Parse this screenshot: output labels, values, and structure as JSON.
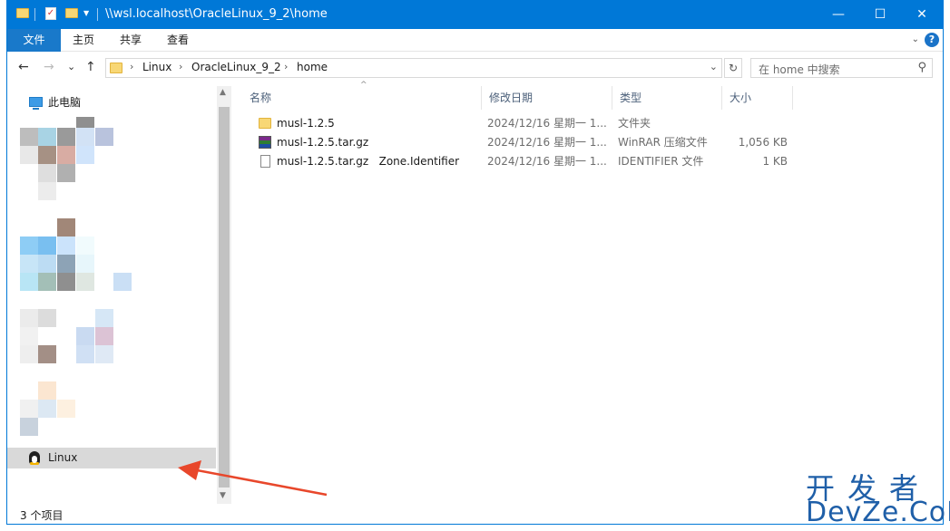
{
  "titlebar": {
    "path": "\\\\wsl.localhost\\OracleLinux_9_2\\home",
    "minimize": "—",
    "maximize": "☐",
    "close": "✕"
  },
  "ribbon": {
    "tabs": [
      "文件",
      "主页",
      "共享",
      "查看"
    ],
    "help": "?"
  },
  "nav": {
    "back": "←",
    "forward": "→",
    "down": "⌄",
    "up": "↑",
    "breadcrumb": [
      "Linux",
      "OracleLinux_9_2",
      "home"
    ],
    "refresh": "↻",
    "search_placeholder": "在 home 中搜索"
  },
  "navpane": {
    "this_pc": "此电脑",
    "linux": "Linux"
  },
  "columns": {
    "name": "名称",
    "date": "修改日期",
    "type": "类型",
    "size": "大小"
  },
  "files": [
    {
      "name": "musl-1.2.5",
      "date": "2024/12/16 星期一 1...",
      "type": "文件夹",
      "size": "",
      "icon": "folder-icon"
    },
    {
      "name": "musl-1.2.5.tar.gz",
      "date": "2024/12/16 星期一 1...",
      "type": "WinRAR 压缩文件",
      "size": "1,056 KB",
      "icon": "winrar-icon"
    },
    {
      "name": "musl-1.2.5.tar.gz   Zone.Identifier",
      "date": "2024/12/16 星期一 1...",
      "type": "IDENTIFIER 文件",
      "size": "1 KB",
      "icon": "document-icon"
    }
  ],
  "status": {
    "count": "3 个项目"
  },
  "watermark": {
    "top": "开发者",
    "bottom": "DevZe.CoM"
  },
  "colors": {
    "accent": "#0078d7",
    "annotation_arrow": "#e8472b"
  }
}
